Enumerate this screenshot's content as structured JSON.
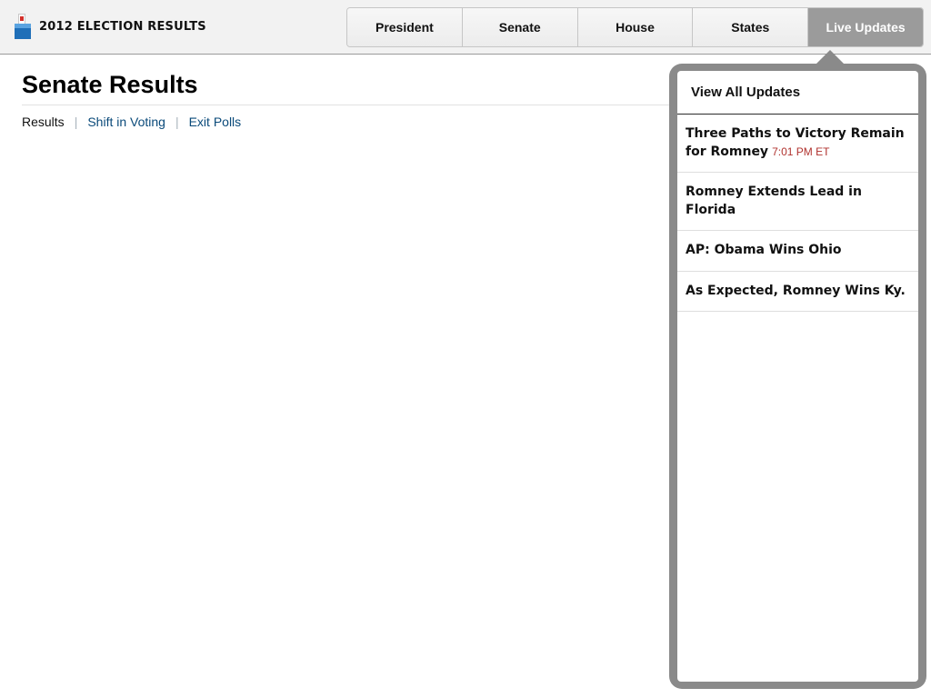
{
  "header": {
    "brand_title": "2012 ELECTION RESULTS",
    "nav_tabs": [
      {
        "label": "President",
        "active": false
      },
      {
        "label": "Senate",
        "active": false
      },
      {
        "label": "House",
        "active": false
      },
      {
        "label": "States",
        "active": false
      },
      {
        "label": "Live Updates",
        "active": true
      }
    ]
  },
  "main": {
    "title": "Senate Results",
    "subnav": [
      {
        "label": "Results",
        "current": true
      },
      {
        "label": "Shift in Voting",
        "current": false
      },
      {
        "label": "Exit Polls",
        "current": false
      }
    ],
    "separator": "|"
  },
  "popover": {
    "header": "View All Updates",
    "updates": [
      {
        "headline": "Three Paths to Victory Remain for Romney",
        "timestamp": "7:01 PM ET"
      },
      {
        "headline": "Romney Extends Lead in Florida",
        "timestamp": ""
      },
      {
        "headline": "AP: Obama Wins Ohio",
        "timestamp": ""
      },
      {
        "headline": "As Expected, Romney Wins Ky.",
        "timestamp": ""
      }
    ]
  },
  "colors": {
    "active_tab": "#9b9b9b",
    "link": "#0a4a7a",
    "timestamp": "#b0322e",
    "popover_frame": "#8a8a8a"
  },
  "icons": {
    "brand_icon": "ballot-box-icon"
  }
}
